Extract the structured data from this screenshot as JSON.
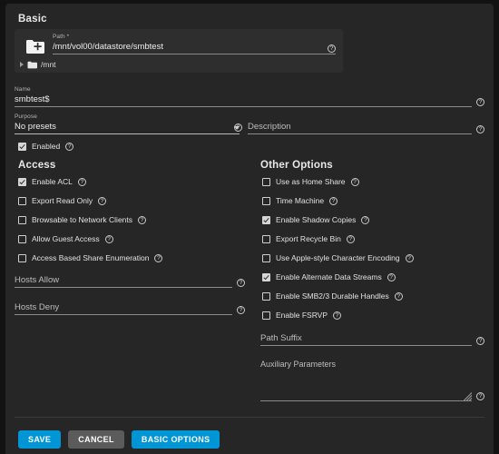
{
  "card": {
    "basic_section_title": "Basic",
    "path": {
      "label": "Path *",
      "value": "/mnt/vol00/datastore/smbtest",
      "help": "?",
      "add_folder_icon": "folder-add-icon",
      "tree": {
        "caret": "chevron-right-icon",
        "folder_icon": "folder-icon",
        "label": "/mnt"
      }
    },
    "name": {
      "label": "Name",
      "value": "smbtest$",
      "help": "?"
    },
    "purpose": {
      "label": "Purpose",
      "value": "No presets",
      "help": "?",
      "options": [
        "No presets"
      ]
    },
    "description": {
      "label": "Description",
      "value": "",
      "help": "?"
    },
    "enabled": {
      "label": "Enabled",
      "checked": true,
      "help": "?"
    }
  },
  "access": {
    "title": "Access",
    "checkboxes": [
      {
        "label": "Enable ACL",
        "checked": true,
        "help": "?"
      },
      {
        "label": "Export Read Only",
        "checked": false,
        "help": "?"
      },
      {
        "label": "Browsable to Network Clients",
        "checked": false,
        "help": "?"
      },
      {
        "label": "Allow Guest Access",
        "checked": false,
        "help": "?"
      },
      {
        "label": "Access Based Share Enumeration",
        "checked": false,
        "help": "?"
      }
    ],
    "hosts_allow": {
      "label": "Hosts Allow",
      "value": "",
      "help": "?"
    },
    "hosts_deny": {
      "label": "Hosts Deny",
      "value": "",
      "help": "?"
    }
  },
  "other_options": {
    "title": "Other Options",
    "checkboxes": [
      {
        "label": "Use as Home Share",
        "checked": false,
        "help": "?"
      },
      {
        "label": "Time Machine",
        "checked": false,
        "help": "?"
      },
      {
        "label": "Enable Shadow Copies",
        "checked": true,
        "help": "?"
      },
      {
        "label": "Export Recycle Bin",
        "checked": false,
        "help": "?"
      },
      {
        "label": "Use Apple-style Character Encoding",
        "checked": false,
        "help": "?"
      },
      {
        "label": "Enable Alternate Data Streams",
        "checked": true,
        "help": "?"
      },
      {
        "label": "Enable SMB2/3 Durable Handles",
        "checked": false,
        "help": "?"
      },
      {
        "label": "Enable FSRVP",
        "checked": false,
        "help": "?"
      }
    ],
    "path_suffix": {
      "label": "Path Suffix",
      "value": "",
      "help": "?"
    },
    "auxiliary_parameters": {
      "label": "Auxiliary Parameters",
      "value": "",
      "help": "?"
    }
  },
  "footer": {
    "save_label": "SAVE",
    "cancel_label": "CANCEL",
    "basic_options_label": "BASIC OPTIONS"
  },
  "colors": {
    "page_background": "#121212",
    "card_background": "#262626",
    "panel_background": "#2e2e2e",
    "accent": "#0095d5",
    "secondary_button": "#5b5b5b",
    "text": "#e8e8e8"
  }
}
